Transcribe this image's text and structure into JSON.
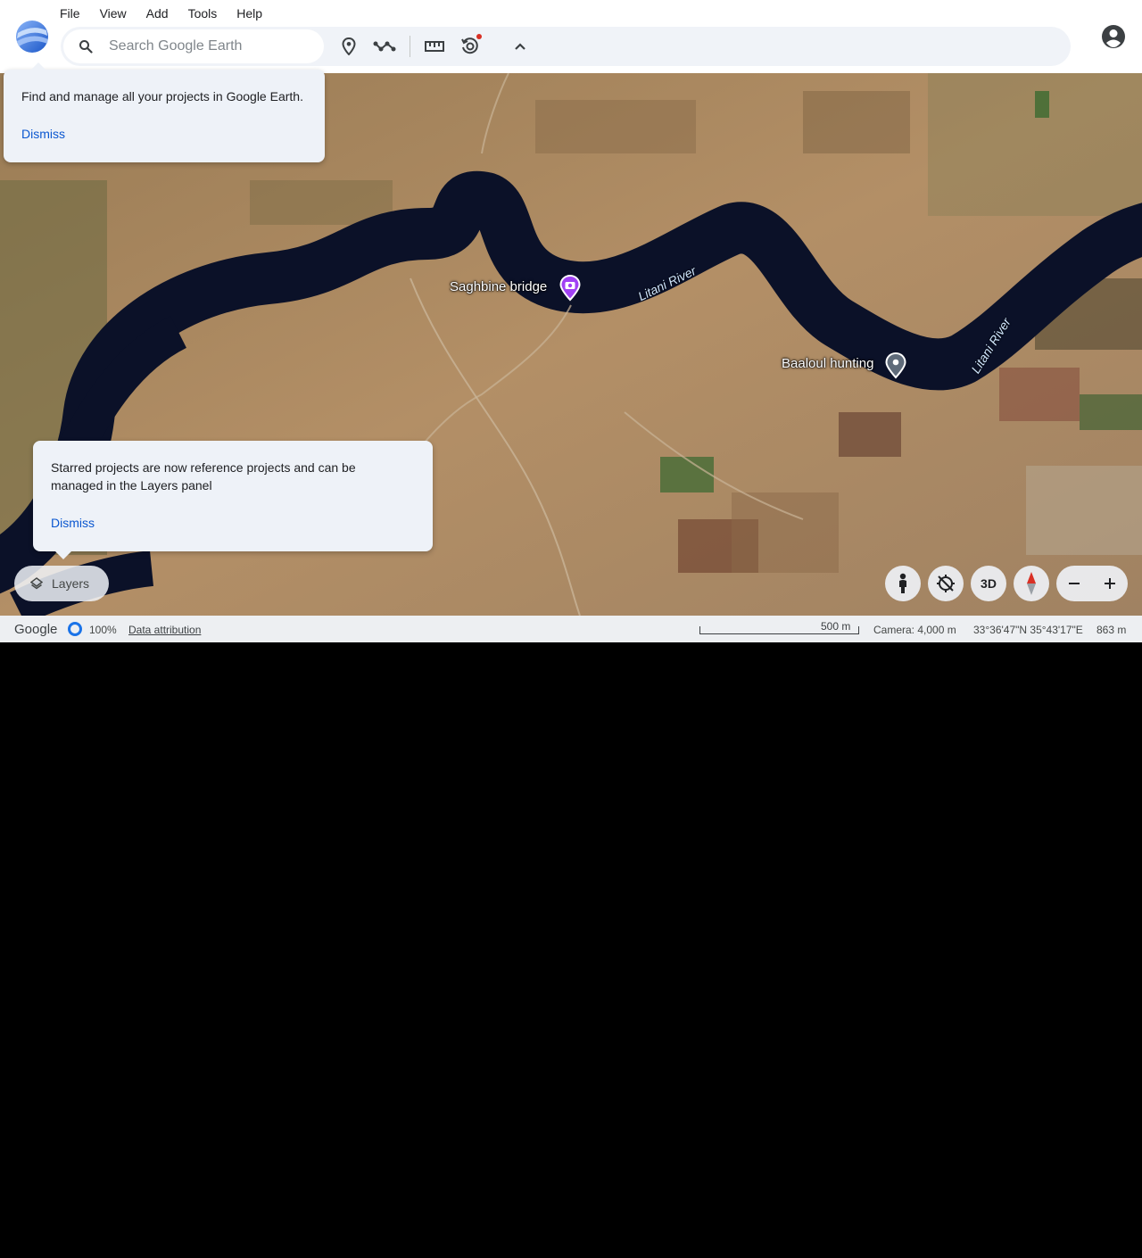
{
  "menu": [
    "File",
    "View",
    "Add",
    "Tools",
    "Help"
  ],
  "search": {
    "placeholder": "Search Google Earth"
  },
  "toolbar_icons": [
    "pin-icon",
    "path-icon",
    "ruler-icon",
    "history-icon",
    "chevron-up-icon"
  ],
  "popups": {
    "projects": {
      "text": "Find and manage all your projects in Google Earth.",
      "dismiss": "Dismiss"
    },
    "starred": {
      "text": "Starred projects are now reference projects and can be managed in the Layers panel",
      "dismiss": "Dismiss"
    }
  },
  "map": {
    "places": [
      {
        "name": "Saghbine bridge",
        "pin_color": "#a142f4"
      },
      {
        "name": "Baaloul hunting",
        "pin_color": "#8ab4f8"
      }
    ],
    "rivers": [
      "Litani River",
      "Litani River"
    ]
  },
  "controls": {
    "layers": "Layers",
    "three_d": "3D"
  },
  "status": {
    "brand": "Google",
    "load_percent": "100%",
    "attribution": "Data attribution",
    "scale": "500 m",
    "camera": "Camera: 4,000 m",
    "coordinates": "33°36'47\"N 35°43'17\"E",
    "elevation": "863 m"
  },
  "colors": {
    "accent": "#0b57d0",
    "toolbar_bg": "#f0f3f8",
    "river": "#0b1128"
  }
}
